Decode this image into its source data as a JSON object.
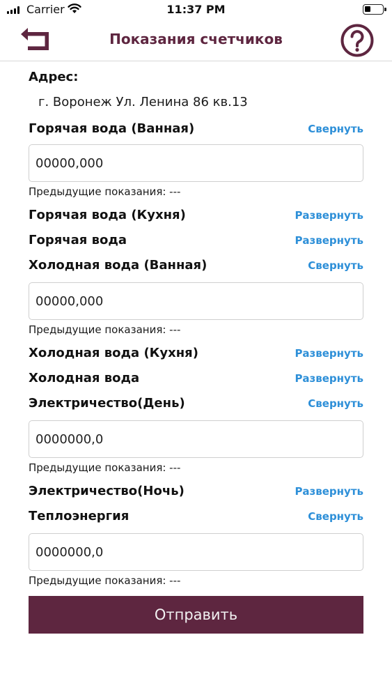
{
  "status_bar": {
    "carrier": "Carrier",
    "time": "11:37 PM"
  },
  "header": {
    "title": "Показания счетчиков",
    "back_icon": "back-arrow-icon",
    "help_icon": "question-circle-icon"
  },
  "address": {
    "label": "Адрес:",
    "value": "г. Воронеж Ул. Ленина 86 кв.13"
  },
  "meters": [
    {
      "title": "Горячая вода (Ванная)",
      "toggle": "Свернуть",
      "expanded": true,
      "placeholder": "00000,000",
      "previous": "Предыдущие показания: ---"
    },
    {
      "title": "Горячая вода (Кухня)",
      "toggle": "Развернуть",
      "expanded": false
    },
    {
      "title": "Горячая вода",
      "toggle": "Развернуть",
      "expanded": false
    },
    {
      "title": "Холодная вода (Ванная)",
      "toggle": "Свернуть",
      "expanded": true,
      "placeholder": "00000,000",
      "previous": "Предыдущие показания: ---"
    },
    {
      "title": "Холодная вода (Кухня)",
      "toggle": "Развернуть",
      "expanded": false
    },
    {
      "title": "Холодная вода",
      "toggle": "Развернуть",
      "expanded": false
    },
    {
      "title": "Электричество(День)",
      "toggle": "Свернуть",
      "expanded": true,
      "placeholder": "0000000,0",
      "previous": "Предыдущие показания: ---"
    },
    {
      "title": "Электричество(Ночь)",
      "toggle": "Развернуть",
      "expanded": false
    },
    {
      "title": "Теплоэнергия",
      "toggle": "Свернуть",
      "expanded": true,
      "placeholder": "0000000,0",
      "previous": "Предыдущие показания: ---"
    }
  ],
  "submit": {
    "label": "Отправить"
  },
  "colors": {
    "brand": "#5e2640",
    "link": "#2d8fd8"
  }
}
